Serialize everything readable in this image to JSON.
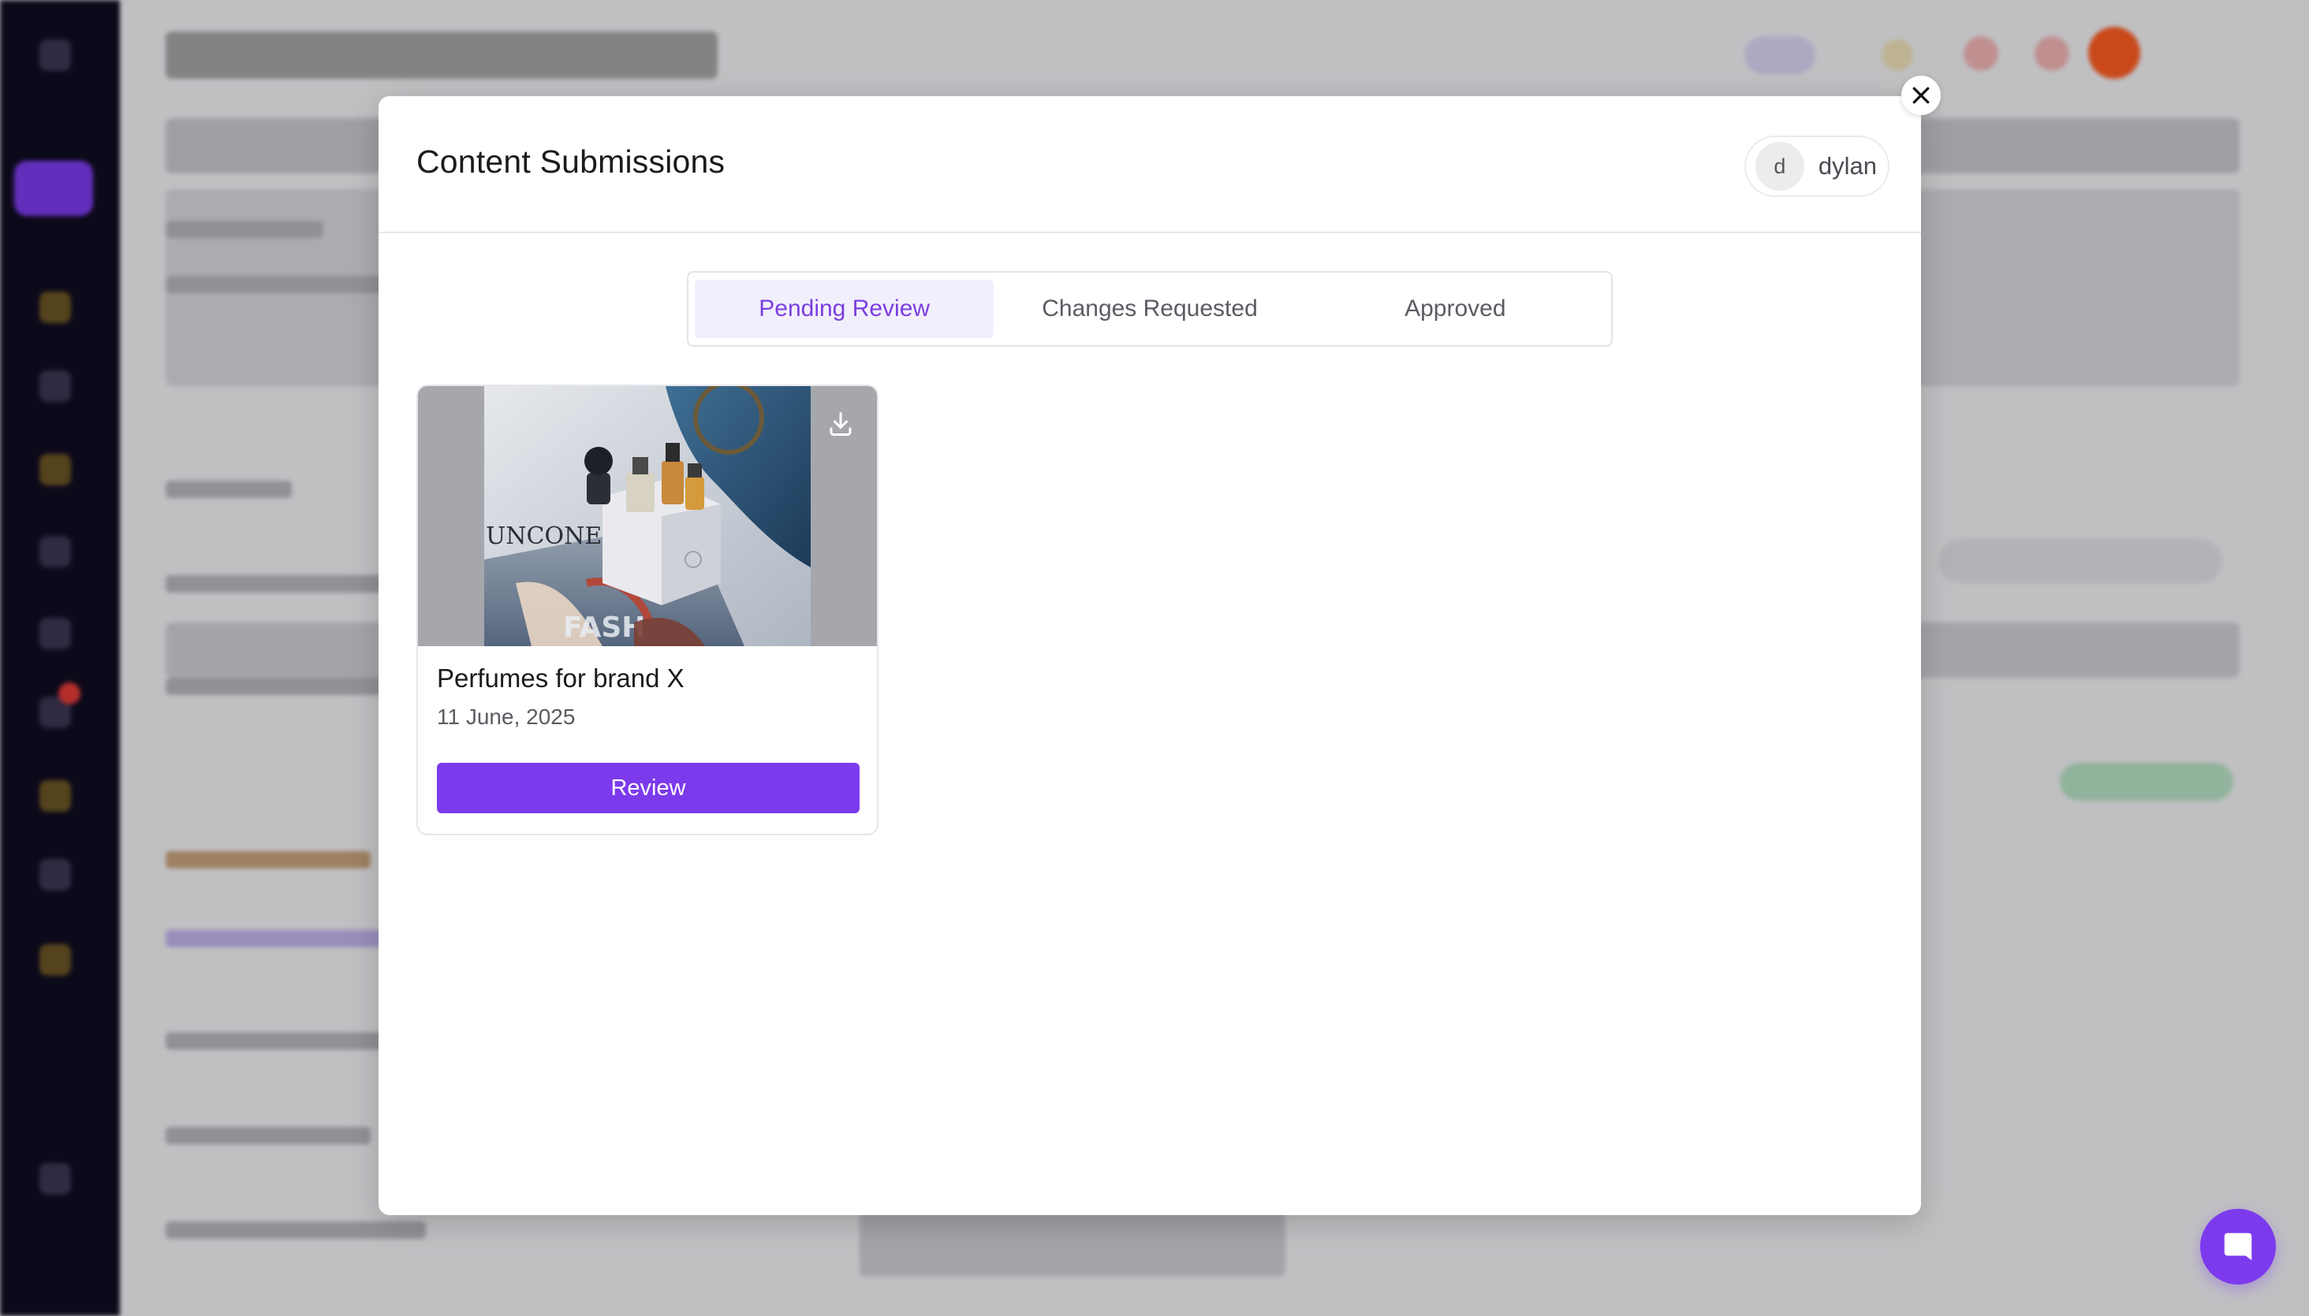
{
  "modal": {
    "title": "Content Submissions",
    "user": {
      "initial": "d",
      "name": "dylan"
    },
    "close_icon": "close-icon"
  },
  "tabs": [
    {
      "label": "Pending Review",
      "active": true
    },
    {
      "label": "Changes Requested",
      "active": false
    },
    {
      "label": "Approved",
      "active": false
    }
  ],
  "submissions": [
    {
      "title": "Perfumes for brand X",
      "date": "11 June, 2025",
      "action_label": "Review",
      "thumbnail": "perfume-bottles-photo",
      "download_icon": "download-icon"
    }
  ],
  "chat": {
    "icon": "chat-bubble-icon"
  },
  "colors": {
    "accent": "#7c3aed",
    "tab_active_bg": "#f2effd",
    "tab_active_text": "#7a3fe0"
  }
}
